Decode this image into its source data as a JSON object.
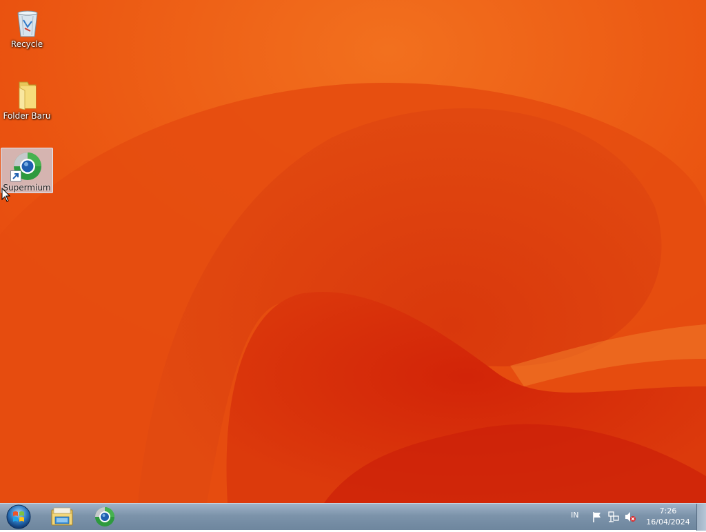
{
  "desktop": {
    "icons": [
      {
        "label": "Recycle",
        "icon": "recycle-bin-icon"
      },
      {
        "label": "Folder Baru",
        "icon": "folder-icon"
      },
      {
        "label": "Supermium",
        "icon": "supermium-browser-icon",
        "shortcut": true,
        "selected": true
      }
    ]
  },
  "taskbar": {
    "start_icon": "windows-start-orb-icon",
    "pinned": [
      {
        "icon": "file-explorer-icon"
      },
      {
        "icon": "supermium-browser-icon"
      }
    ],
    "tray": {
      "language": "IN",
      "icons": [
        "action-center-flag-icon",
        "network-icon",
        "volume-muted-icon"
      ]
    },
    "clock": {
      "time": "7:26",
      "date": "16/04/2024"
    }
  },
  "colors": {
    "wallpaper_base": "#e84a10",
    "wallpaper_dark": "#c8240a",
    "taskbar": "#7c93aa"
  }
}
